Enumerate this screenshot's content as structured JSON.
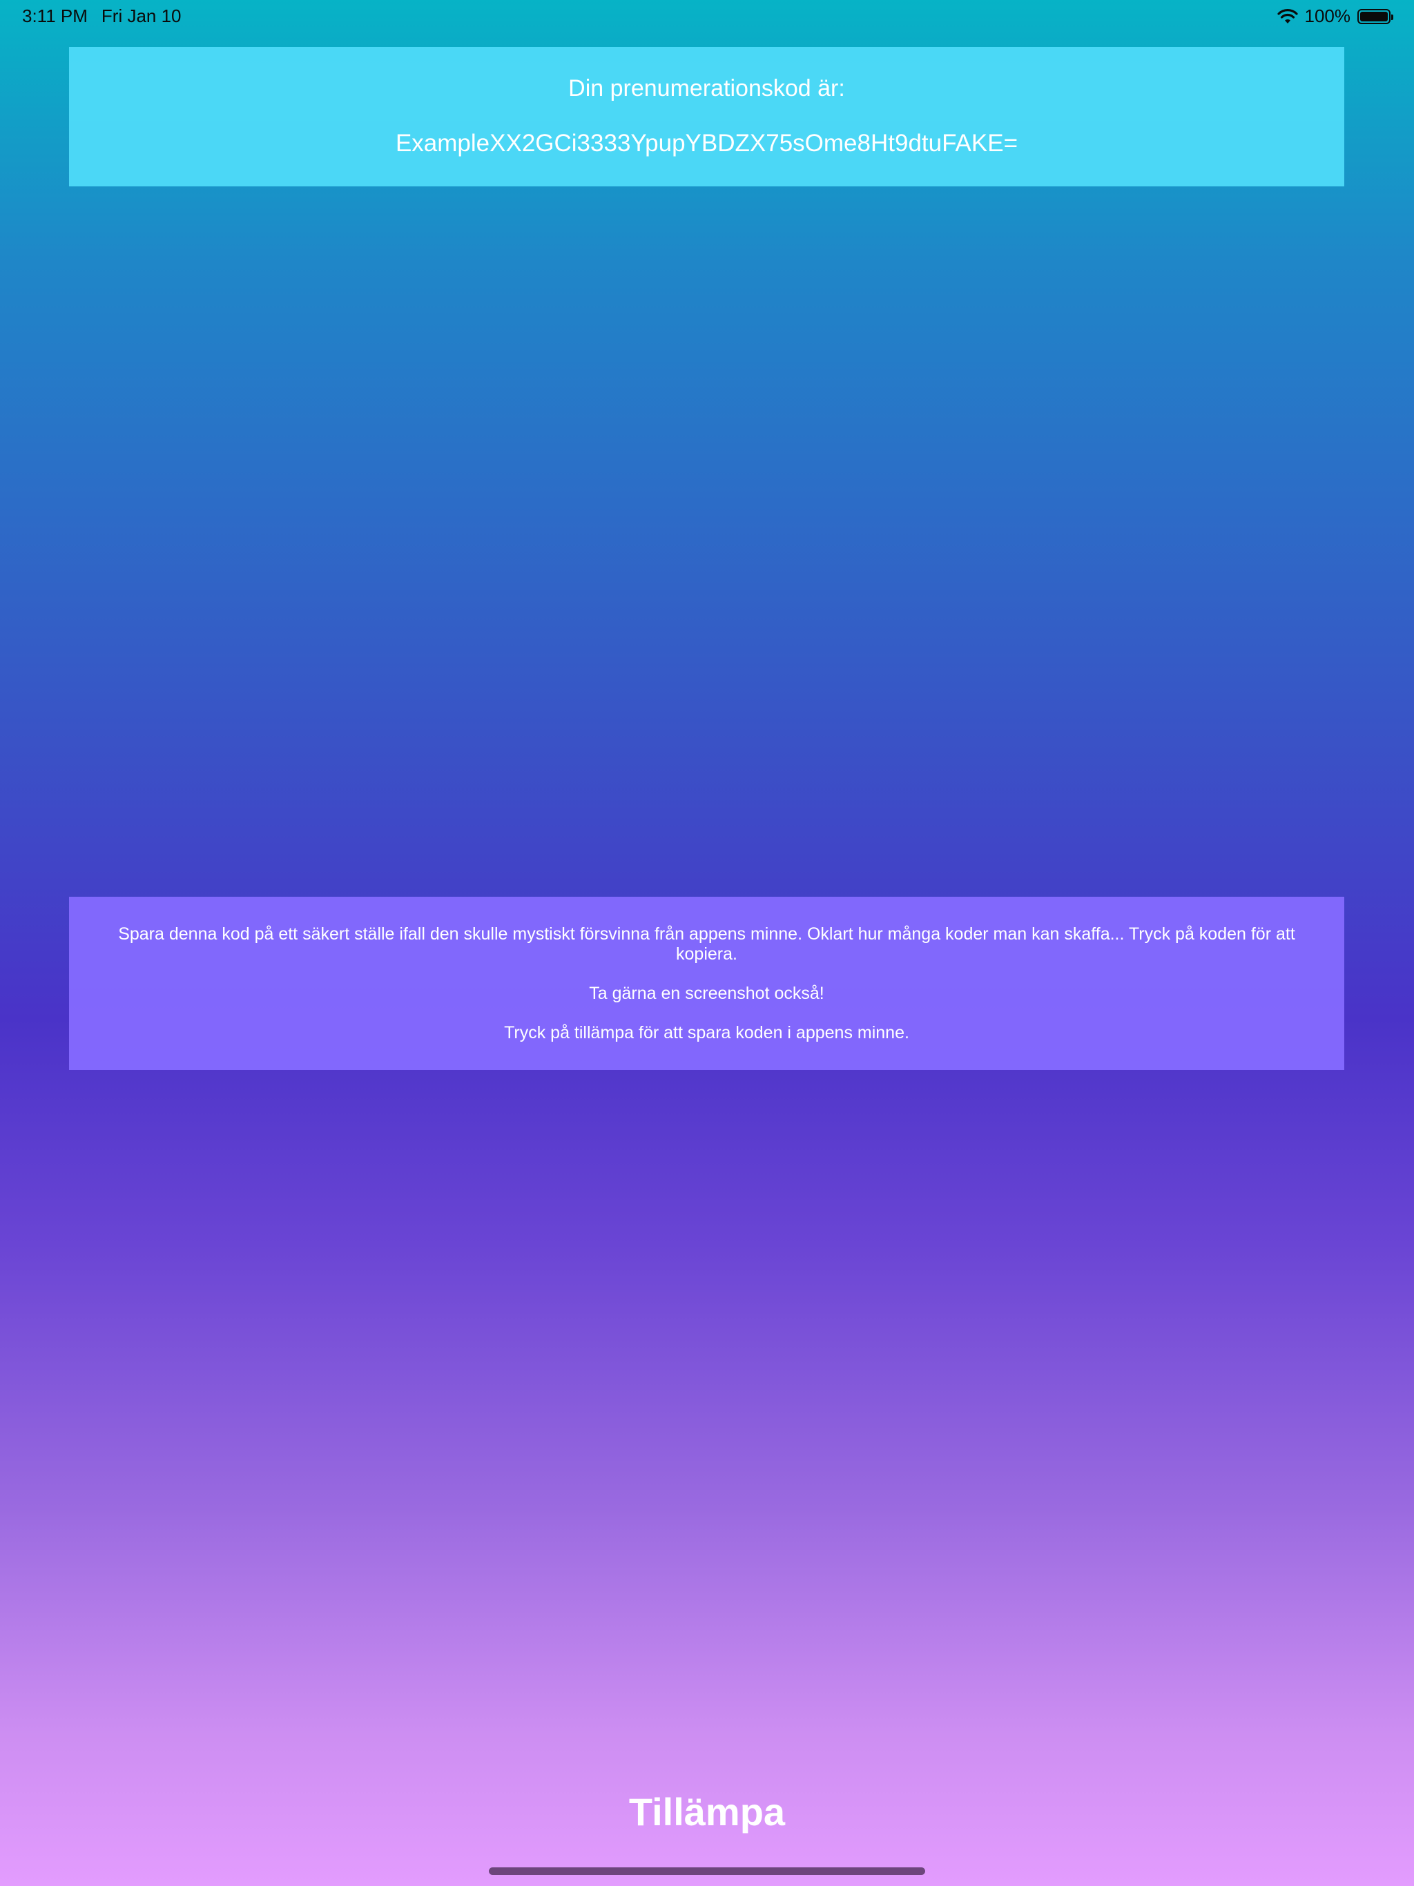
{
  "status_bar": {
    "time": "3:11 PM",
    "date": "Fri Jan 10",
    "battery": "100%",
    "icons": [
      "wifi-icon",
      "battery-icon"
    ]
  },
  "code_panel": {
    "title": "Din prenumerationskod är:",
    "code": "ExampleXX2GCi3333YpupYBDZX75sOme8Ht9dtuFAKE="
  },
  "info_panel": {
    "paragraphs": [
      "Spara denna kod på ett säkert ställe ifall den skulle mystiskt försvinna från appens minne. Oklart hur många koder man kan skaffa... Tryck på koden för att kopiera.",
      "Ta gärna en screenshot också!",
      "Tryck på tillämpa för att spara koden i appens minne."
    ]
  },
  "apply_button": {
    "label": "Tillämpa"
  },
  "colors": {
    "code_panel_bg": "#50dcfa",
    "info_panel_bg": "#856aff",
    "gradient_top": "#07b3c6",
    "gradient_bottom": "#e39cfe"
  }
}
